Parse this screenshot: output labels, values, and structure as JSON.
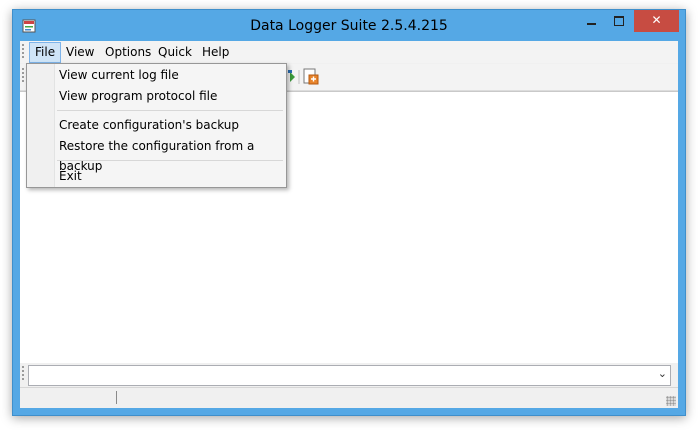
{
  "window": {
    "title": "Data Logger Suite 2.5.4.215",
    "controls": {
      "minimize": "minimize",
      "maximize": "maximize",
      "close": "✕"
    }
  },
  "menubar": {
    "items": [
      {
        "label": "File"
      },
      {
        "label": "View"
      },
      {
        "label": "Options"
      },
      {
        "label": "Quick"
      },
      {
        "label": "Help"
      }
    ]
  },
  "file_menu": {
    "items": [
      {
        "label": "View current log file"
      },
      {
        "label": "View program protocol file"
      },
      {
        "label": "Create configuration's backup"
      },
      {
        "label": "Restore the configuration from a backup"
      },
      {
        "label": "Exit"
      }
    ]
  },
  "combo": {
    "value": ""
  },
  "statusbar": {
    "left": "",
    "right": ""
  },
  "colors": {
    "title_bar": "#55a8e5",
    "close_button": "#c74c42",
    "menu_highlight": "#cfe4f7"
  },
  "icons": [
    "app-icon",
    "minimize-icon",
    "maximize-icon",
    "close-icon",
    "toolbar-arrow-icon",
    "toolbar-document-icon",
    "dropdown-arrow-icon"
  ]
}
